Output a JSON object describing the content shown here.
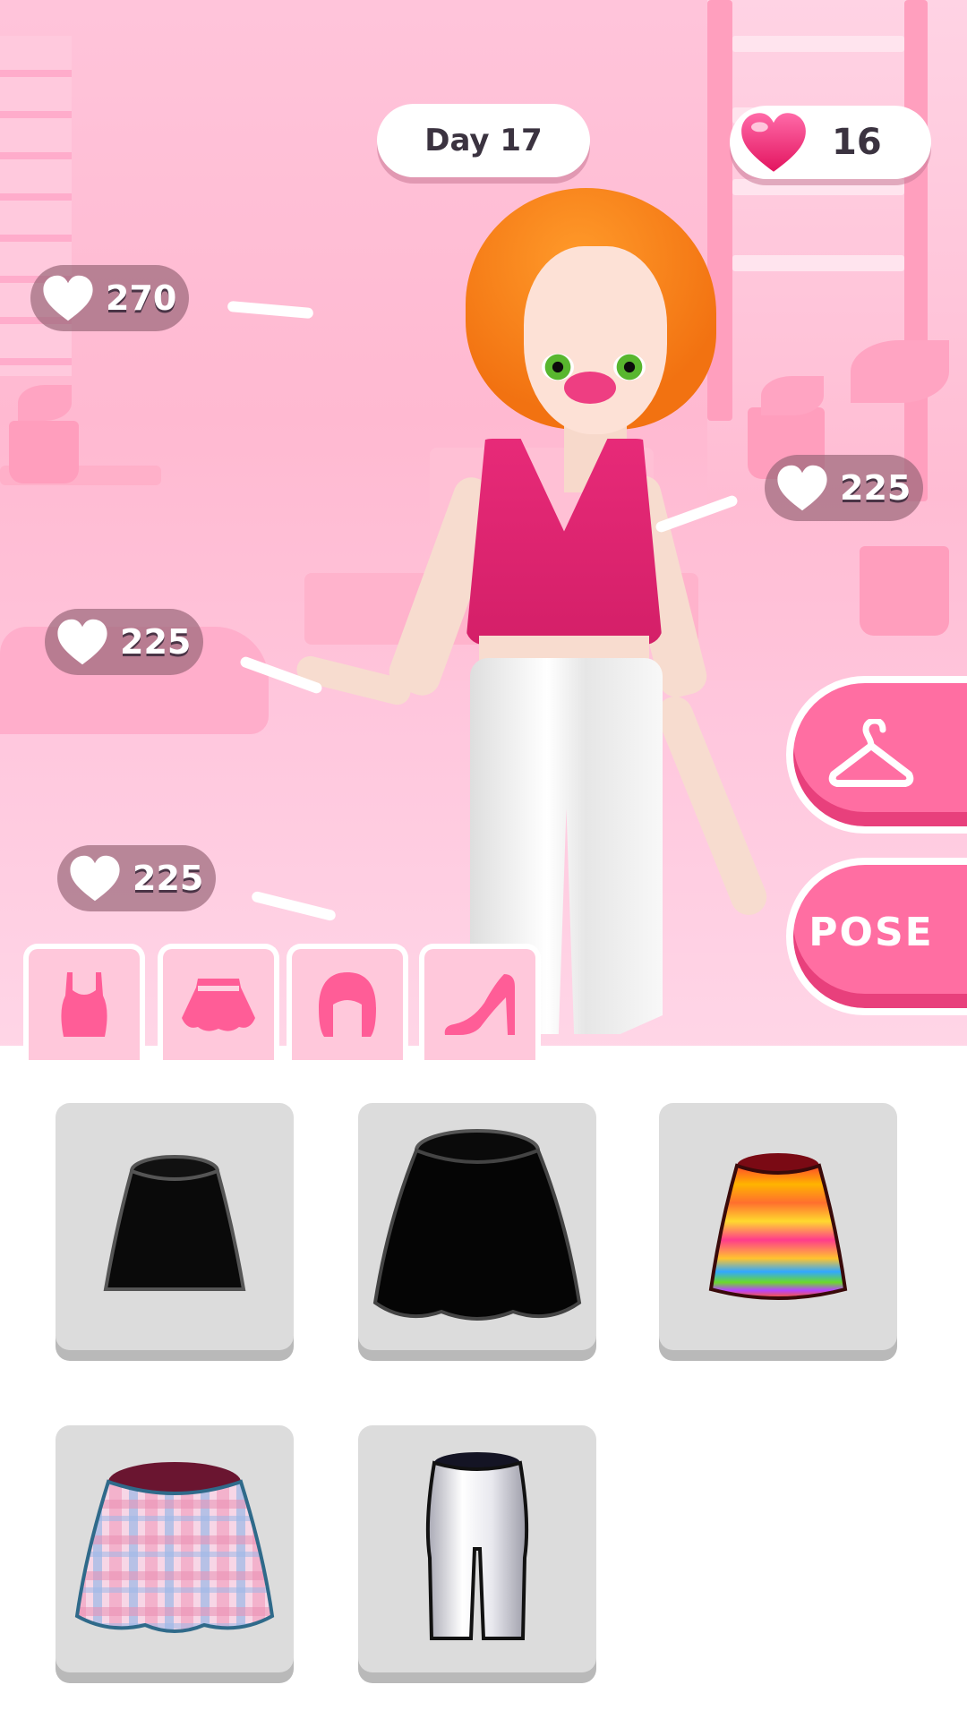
{
  "hud": {
    "day_label": "Day 17",
    "hearts_count": "16",
    "hearts_icon": "heart-icon"
  },
  "scores": [
    {
      "value": "270"
    },
    {
      "value": "225"
    },
    {
      "value": "225"
    },
    {
      "value": "225"
    }
  ],
  "buttons": {
    "wardrobe_icon": "hanger-icon",
    "pose_label": "POSE"
  },
  "category_tabs": [
    {
      "icon": "top-icon"
    },
    {
      "icon": "skirt-icon"
    },
    {
      "icon": "hair-icon"
    },
    {
      "icon": "high-heel-icon"
    }
  ],
  "items": [
    {
      "icon": "black-mini-skirt-icon"
    },
    {
      "icon": "black-tulle-skirt-icon"
    },
    {
      "icon": "rainbow-striped-skirt-icon"
    },
    {
      "icon": "pink-plaid-skirt-icon"
    },
    {
      "icon": "white-capri-pants-icon"
    }
  ],
  "colors": {
    "accent_pink": "#ff6ea2",
    "tab_icon_pink": "#ff5d97",
    "scene_pink": "#ffbfd6"
  }
}
